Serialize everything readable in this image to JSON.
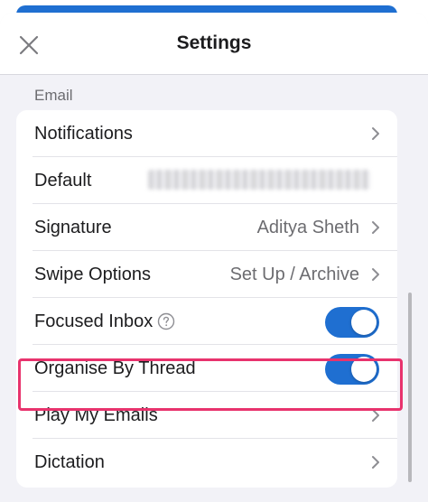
{
  "header": {
    "title": "Settings",
    "close_icon": "close-icon"
  },
  "section": {
    "label": "Email"
  },
  "rows": [
    {
      "label": "Notifications",
      "value": "",
      "control": "chevron"
    },
    {
      "label": "Default",
      "value": "",
      "control": "chevron",
      "note": "email address blurred"
    },
    {
      "label": "Signature",
      "value": "Aditya Sheth",
      "control": "chevron"
    },
    {
      "label": "Swipe Options",
      "value": "Set Up / Archive",
      "control": "chevron"
    },
    {
      "label": "Focused Inbox",
      "value": "",
      "control": "toggle",
      "toggle_on": true,
      "help_icon": "question-circle-icon"
    },
    {
      "label": "Organise By Thread",
      "value": "",
      "control": "toggle",
      "toggle_on": true,
      "highlighted": true
    },
    {
      "label": "Play My Emails",
      "value": "",
      "control": "chevron"
    },
    {
      "label": "Dictation",
      "value": "",
      "control": "chevron"
    }
  ],
  "colors": {
    "accent": "#1f6fd1",
    "highlight": "#e8336d",
    "background": "#f2f2f7"
  }
}
